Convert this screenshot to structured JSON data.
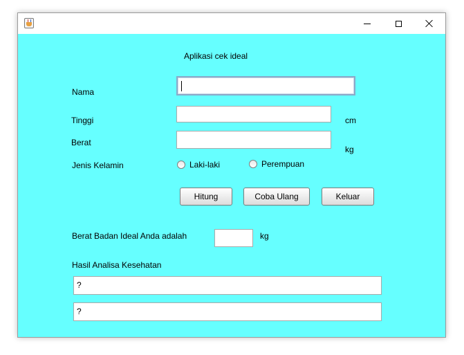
{
  "window": {
    "icon": "java-cup-icon",
    "controls": {
      "minimize": "minimize-icon",
      "maximize": "maximize-icon",
      "close": "close-icon"
    }
  },
  "form": {
    "title": "Aplikasi cek ideal",
    "nama_label": "Nama",
    "nama_value": "",
    "tinggi_label": "Tinggi",
    "tinggi_value": "",
    "tinggi_unit": "cm",
    "berat_label": "Berat",
    "berat_value": "",
    "berat_unit": "kg",
    "gender_label": "Jenis Kelamin",
    "gender_options": [
      "Laki-laki",
      "Perempuan"
    ],
    "gender_selected": null
  },
  "buttons": {
    "hitung": "Hitung",
    "coba_ulang": "Coba Ulang",
    "keluar": "Keluar"
  },
  "result": {
    "ideal_label": "Berat Badan Ideal Anda adalah",
    "ideal_value": "",
    "ideal_unit": "kg",
    "analysis_label": "Hasil Analisa Kesehatan",
    "analysis_line1": "?",
    "analysis_line2": "?"
  },
  "colors": {
    "background": "#66ffff"
  }
}
